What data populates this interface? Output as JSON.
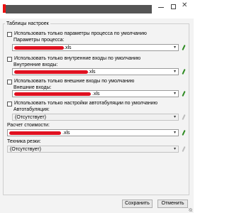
{
  "window": {
    "title_redacted": true
  },
  "group": {
    "title": "Таблицы настроек"
  },
  "sections": {
    "process": {
      "checkbox_label": "Использовать только параметры процесса по умолчанию",
      "field_label": "Параметры процесса:",
      "suffix": ".xls"
    },
    "internal": {
      "checkbox_label": "Использовать только внутренние входы по умолчанию",
      "field_label": "Внутренние входы:",
      "suffix": ".xls"
    },
    "external": {
      "checkbox_label": "Использовать только внешние входы по умолчанию",
      "field_label": "Внешние входы:",
      "suffix": ".xls"
    },
    "tabulation": {
      "checkbox_label": "Использовать только настройки автотабуляции по умолчанию",
      "field_label": "Автотабуляция:",
      "value": "(Отсутствует)"
    },
    "cost": {
      "field_label": "Расчет стоимости:",
      "suffix": ".xls"
    },
    "cutting": {
      "field_label": "Техника резки:",
      "value": "(Отсутствует)"
    }
  },
  "buttons": {
    "save": "Сохранить",
    "cancel": "Отменить"
  },
  "colors": {
    "redaction": "#e01020",
    "edit_icon": "#2e8b22"
  },
  "icons": {
    "dropdown": "chevron-down-icon",
    "edit": "pencil-icon"
  }
}
